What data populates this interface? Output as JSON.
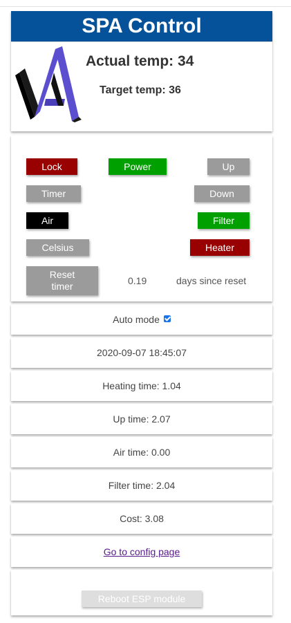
{
  "header": {
    "title": "SPA Control"
  },
  "status": {
    "actual_temp": "Actual temp: 34",
    "target_temp": "Target temp: 36"
  },
  "controls": {
    "lock": "Lock",
    "power": "Power",
    "up": "Up",
    "timer": "Timer",
    "down": "Down",
    "air": "Air",
    "filter": "Filter",
    "celsius": "Celsius",
    "heater": "Heater",
    "reset_timer": "Reset timer",
    "reset_value": "0.19",
    "reset_caption": "days since reset"
  },
  "rows": {
    "auto_mode_label": "Auto mode",
    "auto_mode_checked": true,
    "datetime": "2020-09-07 18:45:07",
    "heating_time": "Heating time: 1.04",
    "up_time": "Up time: 2.07",
    "air_time": "Air time: 0.00",
    "filter_time": "Filter time: 2.04",
    "cost": "Cost: 3.08",
    "config_link": "Go to config page"
  },
  "reboot": {
    "label": "Reboot ESP module"
  },
  "colors": {
    "header": "#05519a",
    "red": "#990000",
    "green": "#00a000",
    "gray": "#9b9b9b",
    "black": "#000000"
  }
}
